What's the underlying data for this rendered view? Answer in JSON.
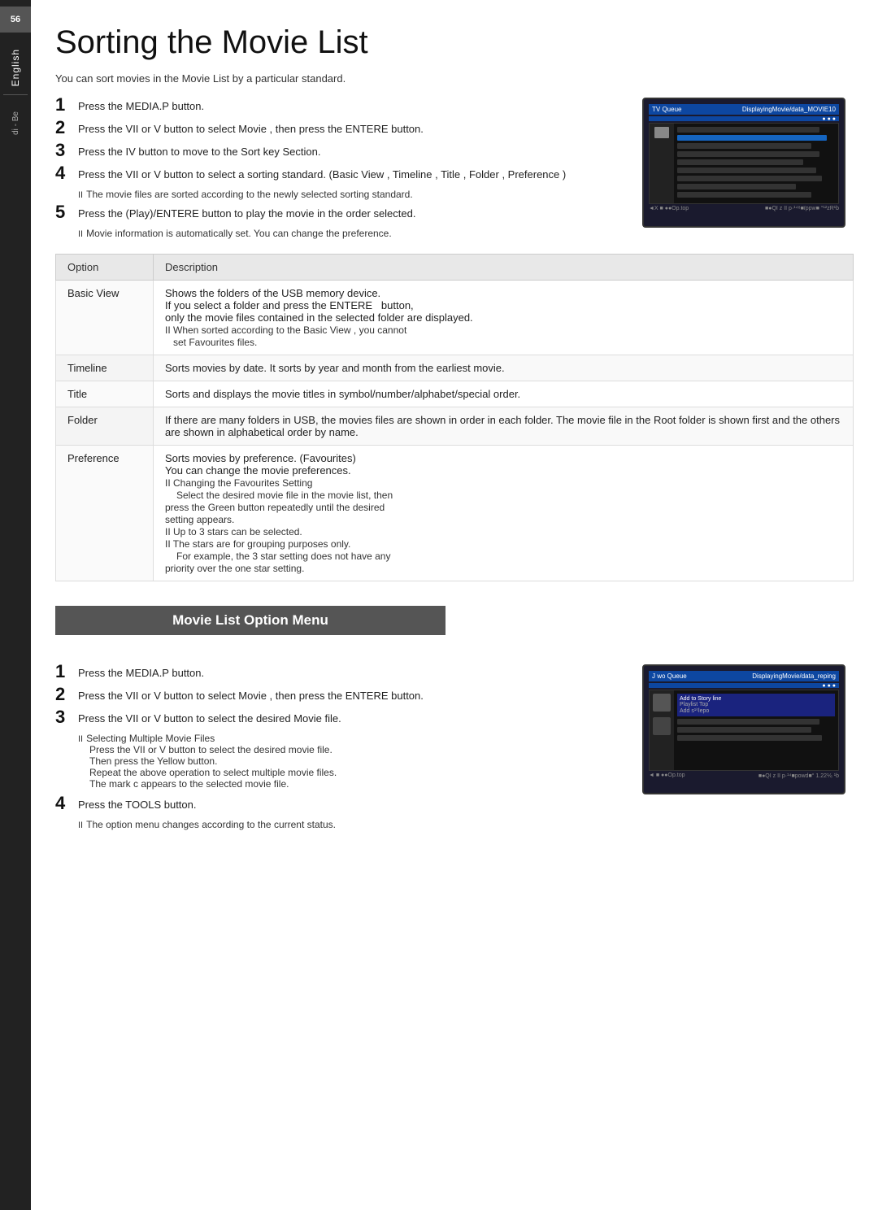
{
  "sidebar": {
    "badge": "56",
    "language": "English",
    "sub": "di - Be"
  },
  "page": {
    "title": "Sorting the Movie List",
    "intro": "You can sort movies in the Movie List by a particular standard."
  },
  "sorting_steps": [
    {
      "number": "1",
      "text": "Press the MEDIA.P button."
    },
    {
      "number": "2",
      "text": "Press the VII or V button to select Movie , then press the ENTERE   button."
    },
    {
      "number": "3",
      "text": "Press the IV button to move to the Sort key Section."
    },
    {
      "number": "4",
      "text": "Press the VII or V button to select a sorting standard. (Basic View , Timeline , Title , Folder , Preference )",
      "note": "The movie files are sorted according to the newly selected sorting standard."
    },
    {
      "number": "5",
      "text": "Press the    (Play)/ENTERE   button to play the movie in the order selected.",
      "note": "Movie information is automatically set. You can change the preference."
    }
  ],
  "table": {
    "col_option": "Option",
    "col_description": "Description",
    "rows": [
      {
        "option": "Basic View",
        "description": "Shows the folders of the USB memory device.\nIf you select a folder and press the ENTERE   button,\nonly the movie files contained in the selected folder are\ndisplayed.\nII When sorted according to the Basic View , you cannot\n   set Favourites files."
      },
      {
        "option": "Timeline",
        "description": "Sorts movies by date. It sorts by year and month from the\nearliest movie."
      },
      {
        "option": "Title",
        "description": "Sorts and displays the movie titles in symbol/number/\nalphabet/special order."
      },
      {
        "option": "Folder",
        "description": "If there are many folders in USB, the movies files are\nshown in order in each folder. The movie file in the\nRoot folder is shown first and the others are shown in\nalphabetical order by name."
      },
      {
        "option": "Preference",
        "description": "Sorts movies by preference. (Favourites)\nYou can change the movie preferences.\nII Changing the Favourites Setting\n   Select the desired movie file in the movie list, then\n   press the Green button repeatedly until the desired\n   setting appears.\nII Up to 3 stars can be selected.\nII The stars are for grouping purposes only.\n   For example, the 3 star setting does not have any\n   priority over the one star setting."
      }
    ]
  },
  "section2": {
    "title": "Movie List Option Menu"
  },
  "option_steps": [
    {
      "number": "1",
      "text": "Press the MEDIA.P button."
    },
    {
      "number": "2",
      "text": "Press the VII or V button to select Movie , then press the ENTERE   button."
    },
    {
      "number": "3",
      "text": "Press the VII or V button to select the desired Movie file.",
      "note": "Selecting Multiple Movie Files",
      "sub_notes": [
        "Press the VII or V button to select the desired movie file.",
        "Then press the Yellow button.",
        "Repeat the above operation to select multiple movie files.",
        "The mark c  appears to the selected movie file."
      ]
    },
    {
      "number": "4",
      "text": "Press the TOOLS button.",
      "note": "The option menu changes according to the current status."
    }
  ]
}
